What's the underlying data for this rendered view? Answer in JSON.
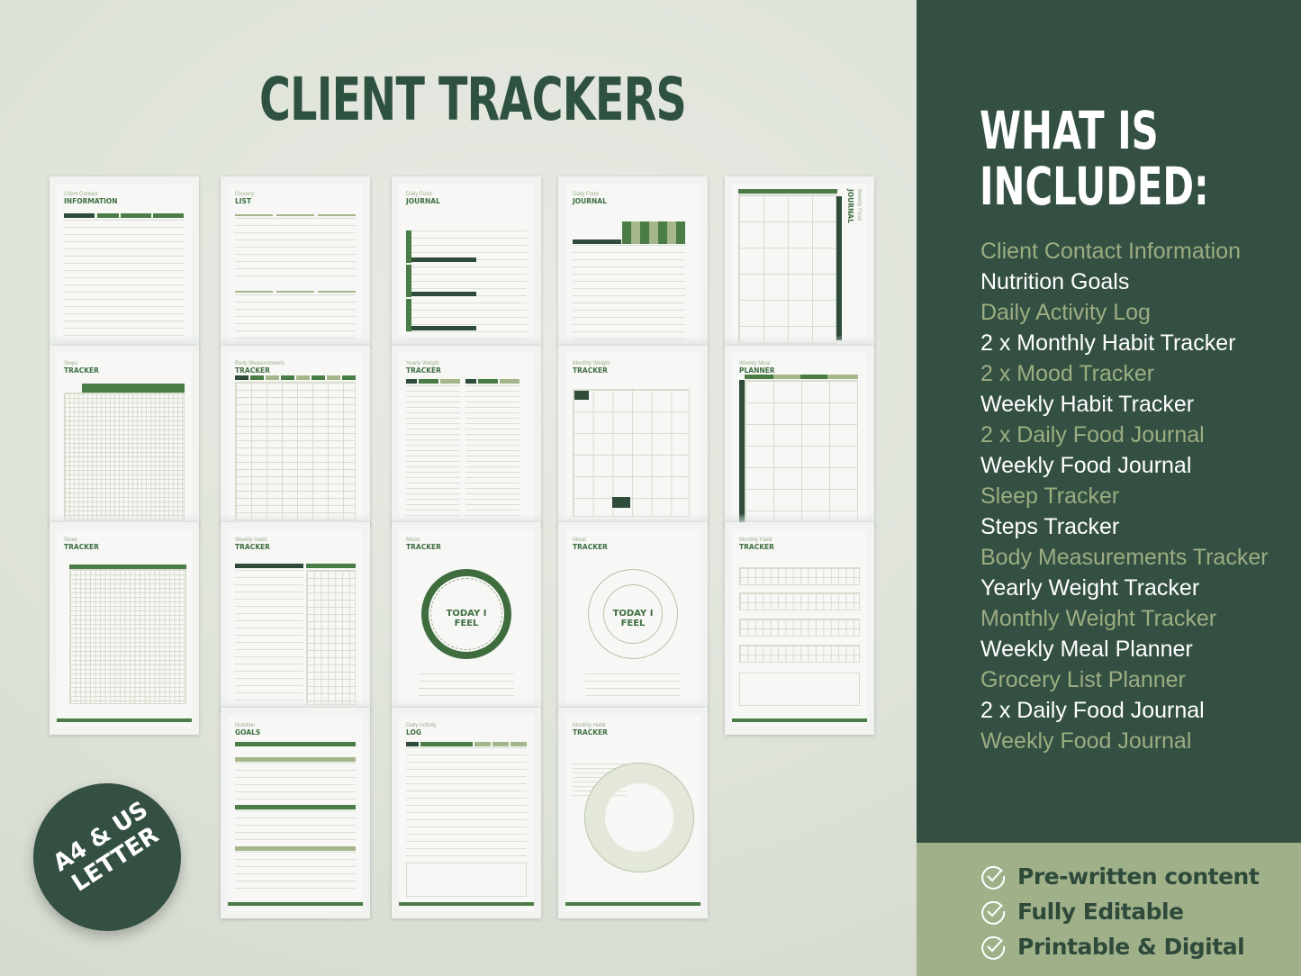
{
  "header": {
    "title": "CLIENT TRACKERS"
  },
  "sidebar": {
    "heading": "WHAT IS\nINCLUDED:",
    "heading_line1": "WHAT IS",
    "heading_line2": "INCLUDED:",
    "items": [
      "Client Contact Information",
      "Nutrition Goals",
      "Daily Activity Log",
      "2 x Monthly Habit Tracker",
      "2 x Mood Tracker",
      "Weekly Habit Tracker",
      "2 x Daily Food Journal",
      "Weekly Food Journal",
      "Sleep Tracker",
      "Steps Tracker",
      "Body Measurements Tracker",
      "Yearly Weight Tracker",
      "Monthly Weight Tracker",
      "Weekly Meal Planner",
      "Grocery List Planner",
      "2 x Daily Food Journal",
      "Weekly Food Journal"
    ]
  },
  "features": [
    {
      "icon": "check-circle-icon",
      "label": "Pre-written content"
    },
    {
      "icon": "check-circle-icon",
      "label": "Fully Editable"
    },
    {
      "icon": "check-circle-icon",
      "label": "Printable & Digital"
    }
  ],
  "badge": {
    "line1": "A4 & US",
    "line2": "LETTER"
  },
  "colors": {
    "dark_green": "#345042",
    "sage": "#a0b18a",
    "accent_text": "#9cad82",
    "title_green": "#2f5240",
    "page_green": "#4a7c46"
  },
  "pages": [
    {
      "sub": "Client Contact",
      "title": "INFORMATION"
    },
    {
      "sub": "Grocery",
      "title": "LIST"
    },
    {
      "sub": "Daily Food",
      "title": "JOURNAL"
    },
    {
      "sub": "Daily Food",
      "title": "JOURNAL"
    },
    {
      "sub": "Weekly Food",
      "title": "JOURNAL"
    },
    {
      "sub": "Steps",
      "title": "TRACKER"
    },
    {
      "sub": "Body Measurements",
      "title": "TRACKER"
    },
    {
      "sub": "Yearly Weight",
      "title": "TRACKER"
    },
    {
      "sub": "Monthly Weight",
      "title": "TRACKER"
    },
    {
      "sub": "Weekly Meal",
      "title": "PLANNER"
    },
    {
      "sub": "Sleep",
      "title": "TRACKER"
    },
    {
      "sub": "Weekly Habit",
      "title": "TRACKER"
    },
    {
      "sub": "Mood",
      "title": "TRACKER",
      "center": "TODAY I FEEL"
    },
    {
      "sub": "Mood",
      "title": "TRACKER",
      "center": "TODAY I FEEL"
    },
    {
      "sub": "Monthly Habit",
      "title": "TRACKER"
    },
    {
      "sub": "Nutrition",
      "title": "GOALS"
    },
    {
      "sub": "Daily Activity",
      "title": "LOG"
    },
    {
      "sub": "Monthly Habit",
      "title": "TRACKER"
    }
  ]
}
